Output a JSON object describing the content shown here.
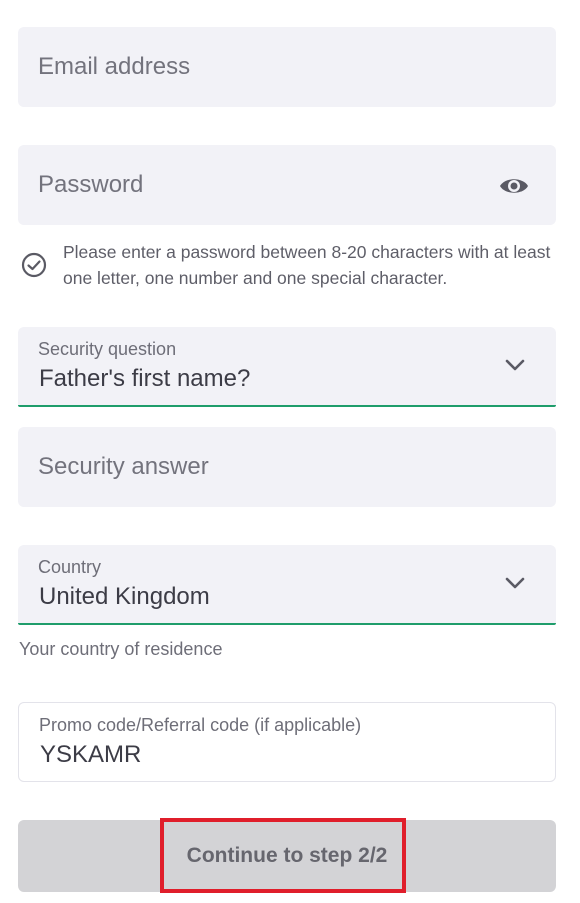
{
  "email": {
    "placeholder": "Email address"
  },
  "password": {
    "placeholder": "Password",
    "toggle_icon": "eye-icon",
    "hint": "Please enter a password between 8-20 characters with at least one letter, one number and one special character.",
    "hint_icon": "check-circle-icon"
  },
  "security_question": {
    "label": "Security question",
    "value": "Father's first name?",
    "icon": "chevron-down-icon"
  },
  "security_answer": {
    "placeholder": "Security answer"
  },
  "country": {
    "label": "Country",
    "value": "United Kingdom",
    "icon": "chevron-down-icon",
    "helper": "Your country of residence"
  },
  "promo": {
    "label": "Promo code/Referral code (if applicable)",
    "value": "YSKAMR"
  },
  "continue_button": {
    "label": "Continue to step 2/2"
  },
  "colors": {
    "field_bg": "#f2f2f7",
    "accent_underline": "#1f9d6b",
    "button_bg": "#d3d3d6",
    "highlight": "#e01e2b"
  }
}
